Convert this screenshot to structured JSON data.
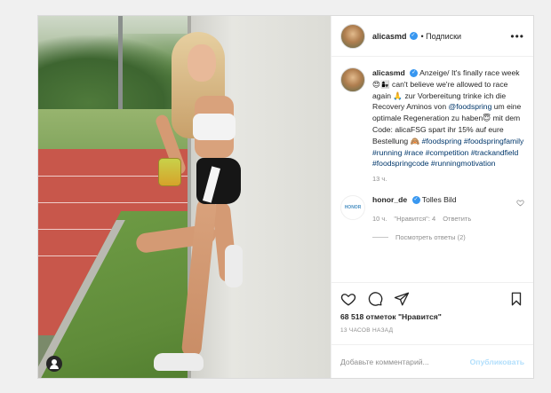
{
  "post": {
    "username": "alicasmd",
    "follow_label": "• Подписки",
    "more_label": "•••",
    "caption_username": "alicasmd",
    "caption_part1": "Anzeige/ It's finally race week",
    "caption_emoji1": "😍👩‍👧",
    "caption_part2": " can't believe we're allowed to race again ",
    "caption_emoji2": "🙏",
    "caption_part3": " zur Vorbereitung trinke ich die Recovery Aminos von ",
    "caption_mention": "@foodspring",
    "caption_part4": " um eine optimale Regeneration zu haben",
    "caption_emoji3": "😇",
    "caption_part5": " mit dem Code: alicaFSG spart ihr 15% auf eure Bestellung ",
    "caption_emoji4": "🙈",
    "hashtags": "#foodspring #foodspringfamily #running #race #competition #trackandfield #foodspringcode #runningmotivation",
    "caption_time": "13 ч.",
    "likes_text": "68 518 отметок \"Нравится\"",
    "posted_ago": "13 ЧАСОВ НАЗАД"
  },
  "comment": {
    "avatar_text": "HONOR",
    "username": "honor_de",
    "text": "Tolles Bild",
    "time": "10 ч.",
    "likes": "\"Нравится\": 4",
    "reply_label": "Ответить",
    "view_replies": "Посмотреть ответы (2)"
  },
  "add_comment": {
    "placeholder": "Добавьте комментарий...",
    "publish_label": "Опубликовать"
  },
  "icons": [
    "heart-icon",
    "comment-icon",
    "share-icon",
    "bookmark-icon",
    "user-tag-icon",
    "verified-icon",
    "more-icon"
  ],
  "colors": {
    "link": "#00376b",
    "verified": "#3897f0",
    "publish": "#b2dffc"
  }
}
